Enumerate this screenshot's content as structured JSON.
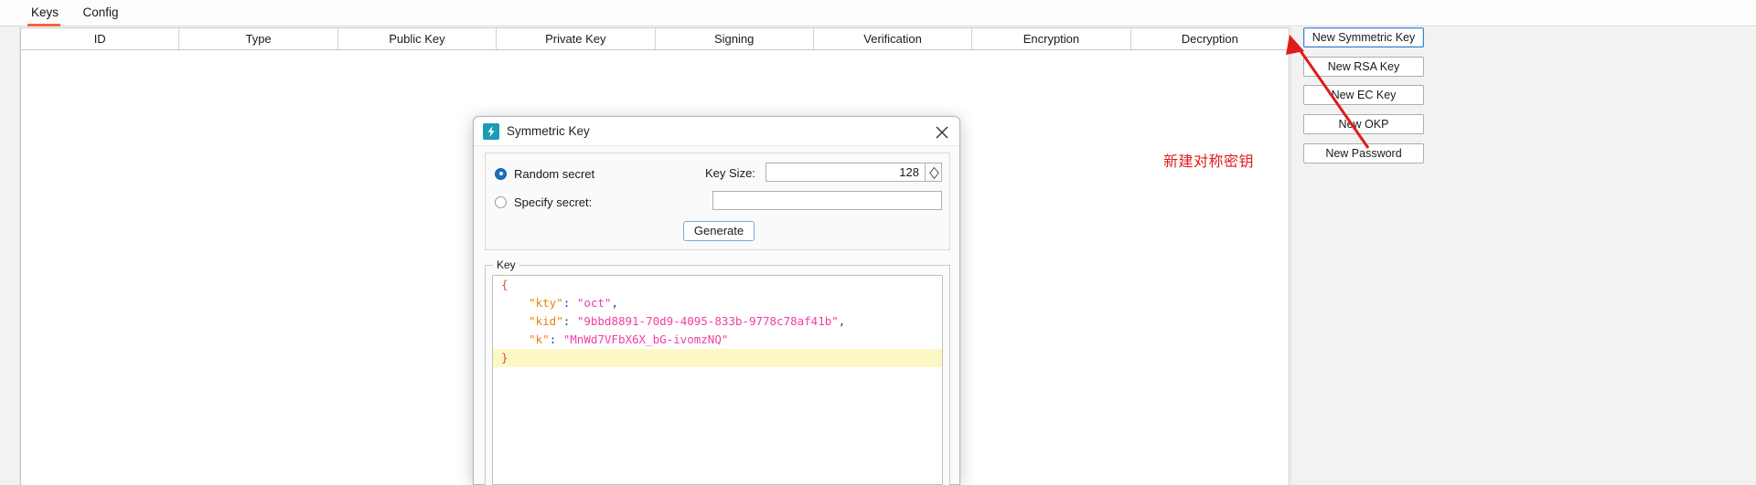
{
  "tabs": [
    {
      "label": "Keys",
      "active": true
    },
    {
      "label": "Config",
      "active": false
    }
  ],
  "table": {
    "columns": [
      "ID",
      "Type",
      "Public Key",
      "Private Key",
      "Signing",
      "Verification",
      "Encryption",
      "Decryption"
    ],
    "rows": []
  },
  "side_panel": {
    "buttons": [
      {
        "label": "New Symmetric Key",
        "focused": true
      },
      {
        "label": "New RSA Key",
        "focused": false
      },
      {
        "label": "New EC Key",
        "focused": false
      },
      {
        "label": "New OKP",
        "focused": false
      },
      {
        "label": "New Password",
        "focused": false
      }
    ]
  },
  "annotation": {
    "text": "新建对称密钥",
    "color": "#e01b1b"
  },
  "dialog": {
    "title": "Symmetric Key",
    "icon": "lightning-bolt-icon",
    "icon_color": "#1b9cb6",
    "close_label": "×",
    "generation": {
      "random_secret": {
        "label": "Random secret",
        "selected": true
      },
      "specify_secret": {
        "label": "Specify secret:",
        "selected": false
      },
      "secret_value": "",
      "key_size_label": "Key Size:",
      "key_size_value": "128",
      "generate_label": "Generate"
    },
    "key_group": {
      "legend": "Key",
      "lines": [
        {
          "text": "{",
          "type": "brace",
          "highlight": false
        },
        {
          "key": "\"kty\"",
          "value": "\"oct\"",
          "trail": ",",
          "indent": 4,
          "highlight": false
        },
        {
          "key": "\"kid\"",
          "value": "\"9bbd8891-70d9-4095-833b-9778c78af41b\"",
          "trail": ",",
          "indent": 4,
          "highlight": false
        },
        {
          "key": "\"k\"",
          "value": "\"MnWd7VFbX6X_bG-ivomzNQ\"",
          "trail": "",
          "indent": 4,
          "highlight": false
        },
        {
          "text": "}",
          "type": "brace",
          "highlight": true
        }
      ],
      "json": {
        "kty": "oct",
        "kid": "9bbd8891-70d9-4095-833b-9778c78af41b",
        "k": "MnWd7VFbX6X_bG-ivomzNQ"
      }
    }
  }
}
